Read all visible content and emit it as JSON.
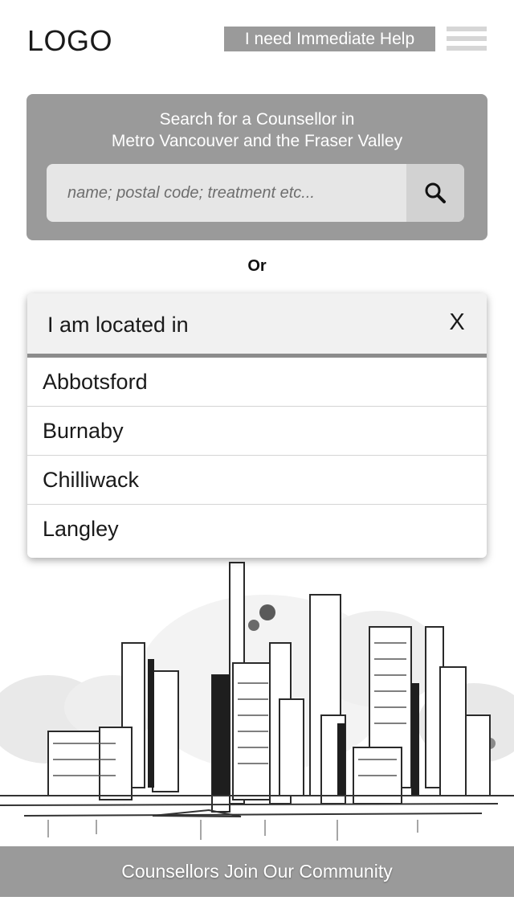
{
  "header": {
    "logo": "LOGO",
    "help_label": "I need Immediate Help",
    "menu_icon": "hamburger-menu-icon"
  },
  "search": {
    "heading_line1": "Search for a Counsellor in",
    "heading_line2": "Metro Vancouver and the Fraser Valley",
    "placeholder": "name; postal code; treatment etc...",
    "value": "",
    "button_icon": "search-icon"
  },
  "or_label": "Or",
  "location_dropdown": {
    "label": "I am located in",
    "close_label": "X",
    "options": [
      "Abbotsford",
      "Burnaby",
      "Chilliwack",
      "Langley"
    ]
  },
  "footer": {
    "cta_label": "Counsellors Join Our Community"
  },
  "colors": {
    "panel_gray": "#9a9a9a",
    "input_bg": "#e6e6e6",
    "search_button_bg": "#d2d2d2",
    "dropdown_header_bg": "#f1f1f1",
    "text": "#1a1a1a"
  }
}
